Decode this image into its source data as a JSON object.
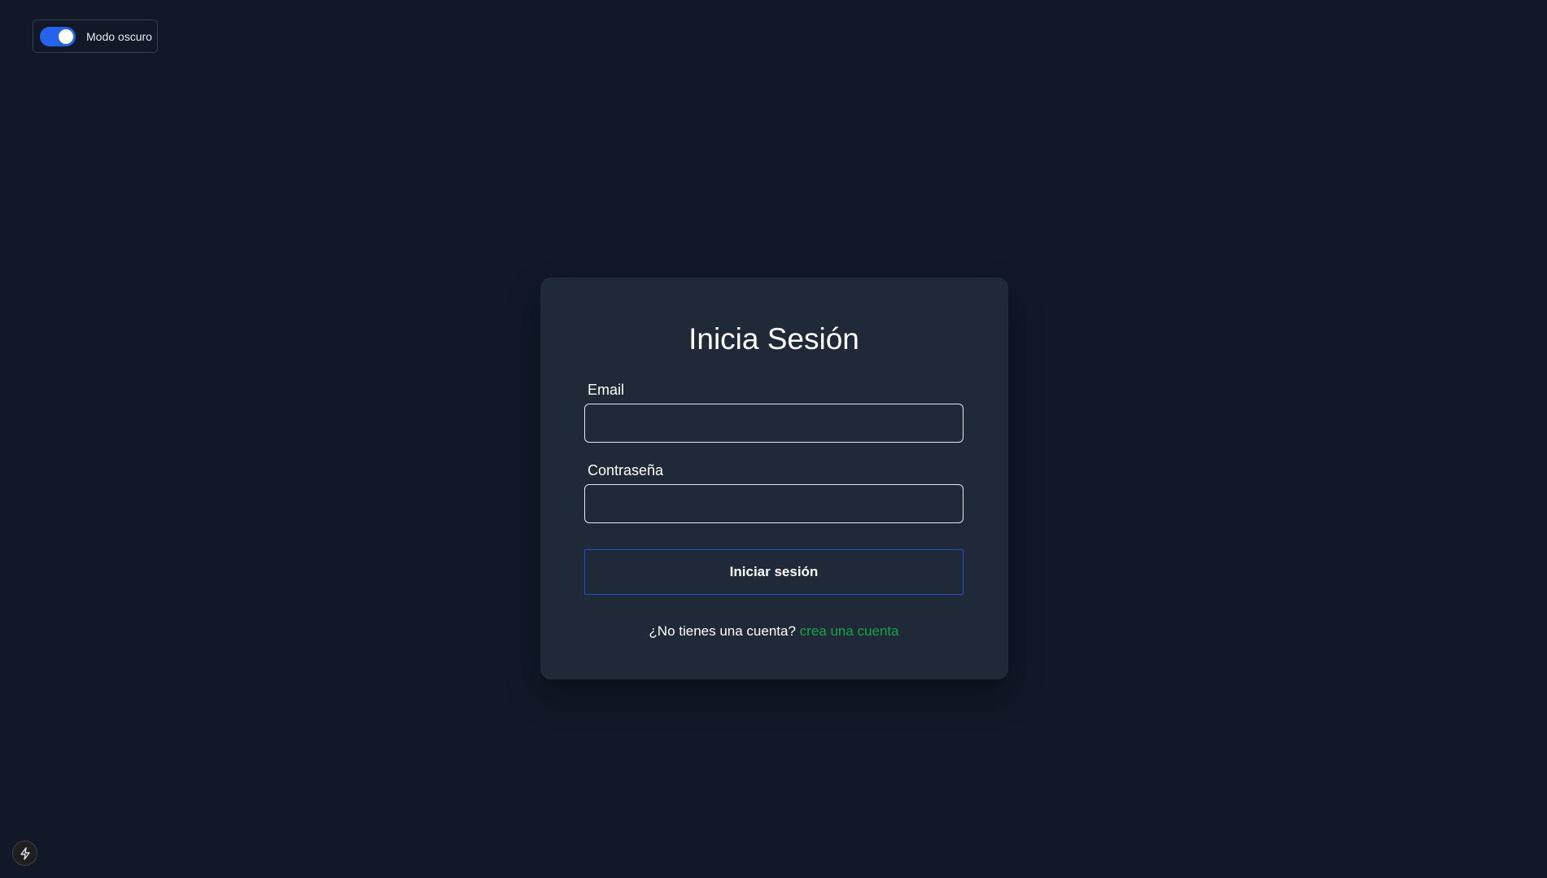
{
  "theme_toggle": {
    "label": "Modo oscuro",
    "checked": true
  },
  "login": {
    "title": "Inicia Sesión",
    "email_label": "Email",
    "email_value": "",
    "password_label": "Contraseña",
    "password_value": "",
    "submit_label": "Iniciar sesión",
    "signup_prompt": "¿No tienes una cuenta?",
    "signup_link": "crea una cuenta"
  },
  "colors": {
    "background": "#111827",
    "card": "#1f2937",
    "accent_blue": "#2563eb",
    "link_green": "#16a34a"
  },
  "icons": {
    "bottom_left_badge": "lightning-bolt-icon"
  }
}
